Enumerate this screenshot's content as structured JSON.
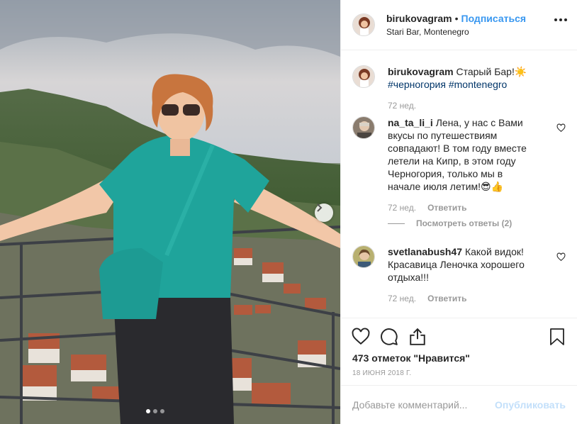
{
  "post_author": {
    "username": "birukovagram",
    "separator": "•",
    "follow_label": "Подписаться",
    "location": "Stari Bar, Montenegro"
  },
  "caption": {
    "username": "birukovagram",
    "text": "Старый Бар!",
    "emoji": "☀️",
    "hashtags": [
      "#черногория",
      "#montenegro"
    ],
    "time": "72 нед."
  },
  "comments": [
    {
      "username": "na_ta_li_i",
      "text": "Лена, у нас с Вами вкусы по путешествиям совпадают! В том году вместе летели на Кипр, в этом году Черногория, только мы в начале июля летим!😎👍",
      "time": "72 нед.",
      "reply_label": "Ответить",
      "view_replies": "Посмотреть ответы (2)"
    },
    {
      "username": "svetlanabush47",
      "text": "Какой видок! Красавица Леночка хорошего отдыха!!!",
      "time": "72 нед.",
      "reply_label": "Ответить"
    }
  ],
  "actions": {
    "likes": "473 отметок \"Нравится\"",
    "date": "18 ИЮНЯ 2018 Г.",
    "icons": [
      "heart-icon",
      "comment-icon",
      "share-icon",
      "bookmark-icon"
    ]
  },
  "add_comment": {
    "placeholder": "Добавьте комментарий...",
    "post_label": "Опубликовать"
  },
  "carousel": {
    "total": 3,
    "active": 1
  },
  "colors": {
    "link": "#3897f0",
    "hashtag": "#003569",
    "muted": "#999999"
  }
}
